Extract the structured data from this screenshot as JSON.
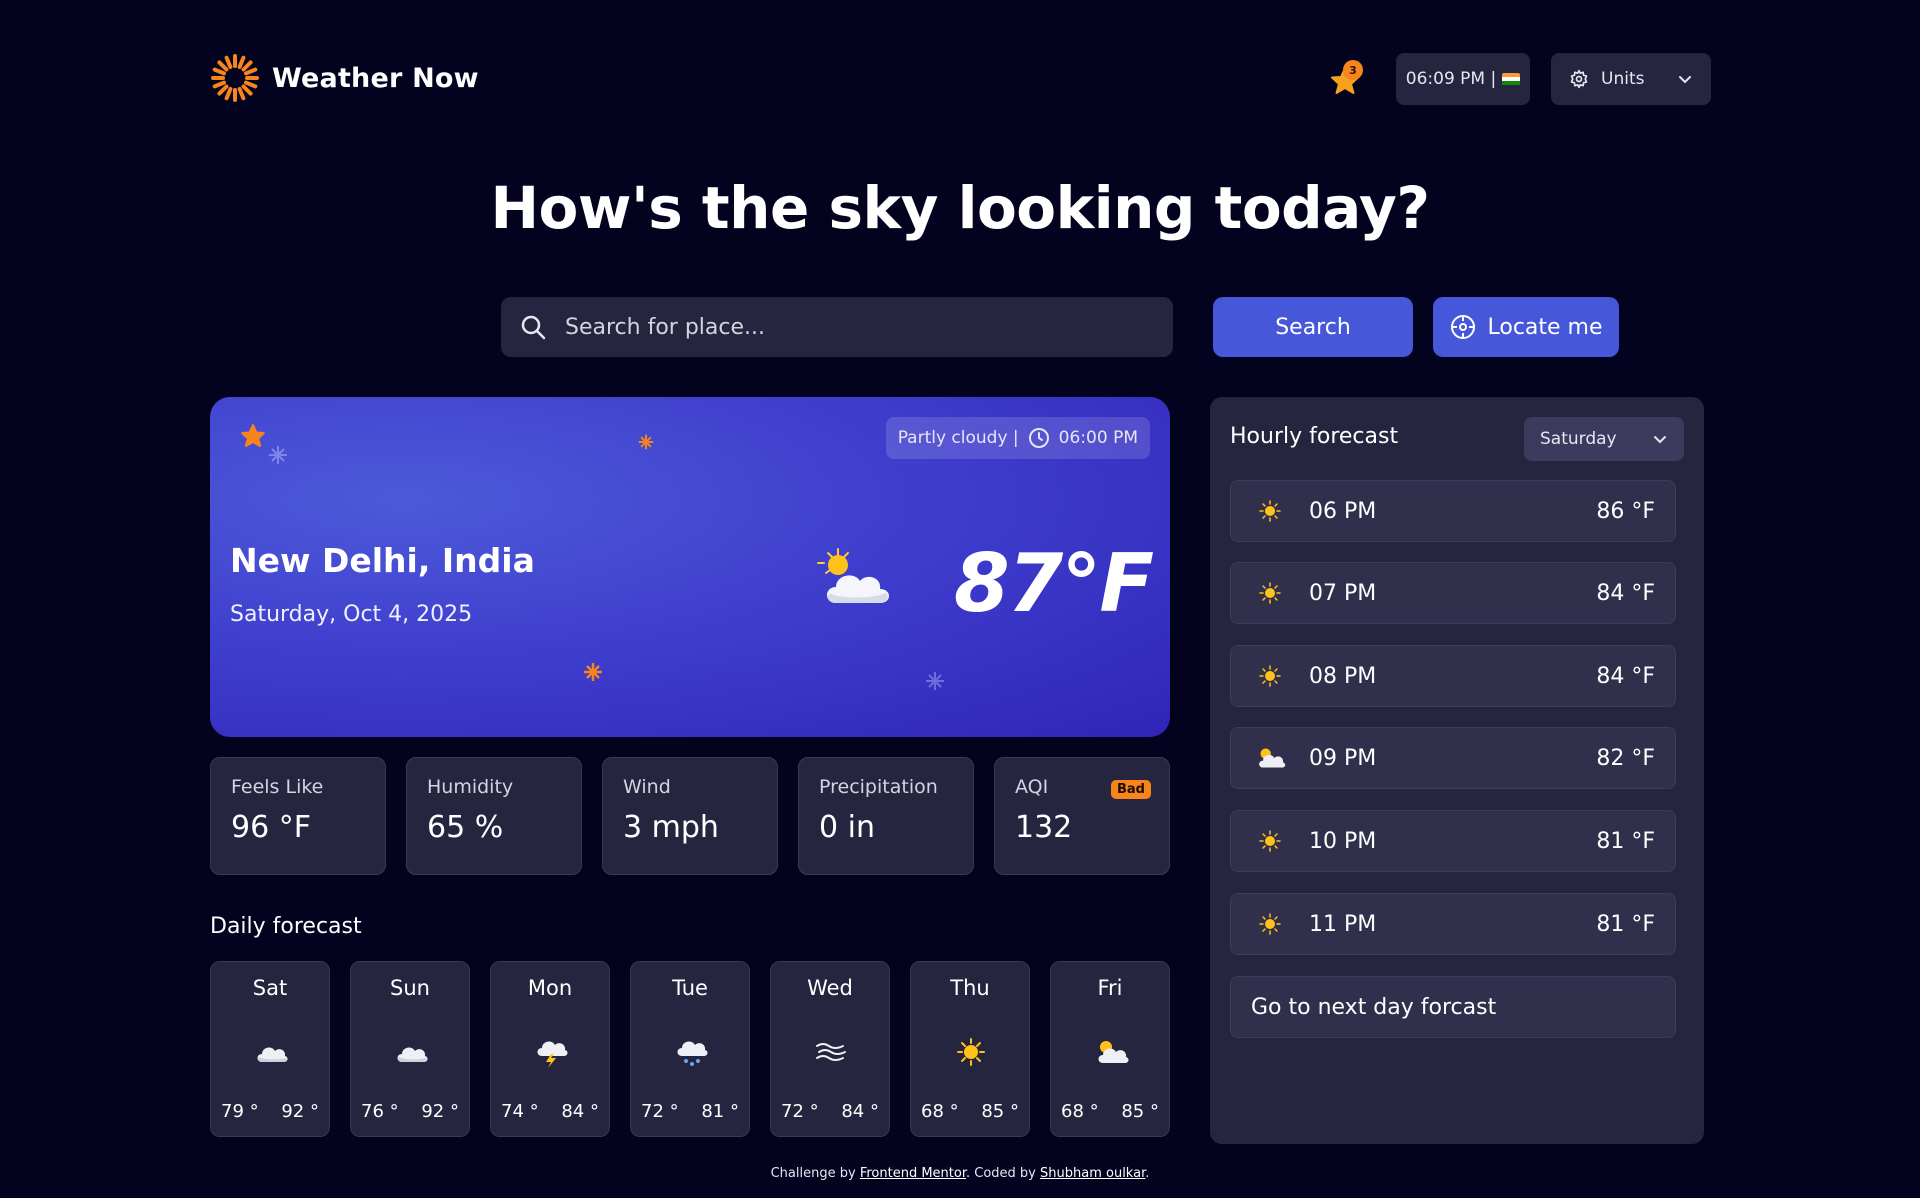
{
  "header": {
    "logo_text": "Weather Now",
    "favorites_count": "3",
    "clock_text": "06:09 PM |",
    "units_label": "Units"
  },
  "hero": {
    "headline": "How's the sky looking today?",
    "search_placeholder": "Search for place...",
    "search_button": "Search",
    "locate_button": "Locate me"
  },
  "current": {
    "condition": "Partly cloudy |",
    "time": "06:00 PM",
    "location": "New Delhi, India",
    "date": "Saturday, Oct 4, 2025",
    "temperature": "87°F",
    "icon": "partly-cloudy-icon"
  },
  "stats": [
    {
      "label": "Feels Like",
      "value": "96 °F"
    },
    {
      "label": "Humidity",
      "value": "65 %"
    },
    {
      "label": "Wind",
      "value": "3 mph"
    },
    {
      "label": "Precipitation",
      "value": "0 in"
    },
    {
      "label": "AQI",
      "value": "132",
      "badge": "Bad"
    }
  ],
  "daily": {
    "title": "Daily forecast",
    "days": [
      {
        "name": "Sat",
        "lo": "79 °",
        "hi": "92 °",
        "icon": "cloud-icon"
      },
      {
        "name": "Sun",
        "lo": "76 °",
        "hi": "92 °",
        "icon": "cloud-icon"
      },
      {
        "name": "Mon",
        "lo": "74 °",
        "hi": "84 °",
        "icon": "storm-icon"
      },
      {
        "name": "Tue",
        "lo": "72 °",
        "hi": "81 °",
        "icon": "snow-icon"
      },
      {
        "name": "Wed",
        "lo": "72 °",
        "hi": "84 °",
        "icon": "fog-icon"
      },
      {
        "name": "Thu",
        "lo": "68 °",
        "hi": "85 °",
        "icon": "sun-icon"
      },
      {
        "name": "Fri",
        "lo": "68 °",
        "hi": "85 °",
        "icon": "partly-cloudy-icon"
      }
    ]
  },
  "hourly": {
    "title": "Hourly forecast",
    "selected_day": "Saturday",
    "hours": [
      {
        "time": "06 PM",
        "temp": "86 °F",
        "icon": "sun-icon"
      },
      {
        "time": "07 PM",
        "temp": "84 °F",
        "icon": "sun-icon"
      },
      {
        "time": "08 PM",
        "temp": "84 °F",
        "icon": "sun-icon"
      },
      {
        "time": "09 PM",
        "temp": "82 °F",
        "icon": "partly-cloudy-icon"
      },
      {
        "time": "10 PM",
        "temp": "81 °F",
        "icon": "sun-icon"
      },
      {
        "time": "11 PM",
        "temp": "81 °F",
        "icon": "sun-icon"
      }
    ],
    "next_day": "Go to next day forcast"
  },
  "footer": {
    "prefix": "Challenge by ",
    "link1": "Frontend Mentor",
    "middle": ". Coded by ",
    "link2": "Shubham oulkar",
    "suffix": "."
  },
  "colors": {
    "background": "#03031f",
    "card": "#262540",
    "accent": "#4657d9",
    "orange": "#f7841c"
  }
}
